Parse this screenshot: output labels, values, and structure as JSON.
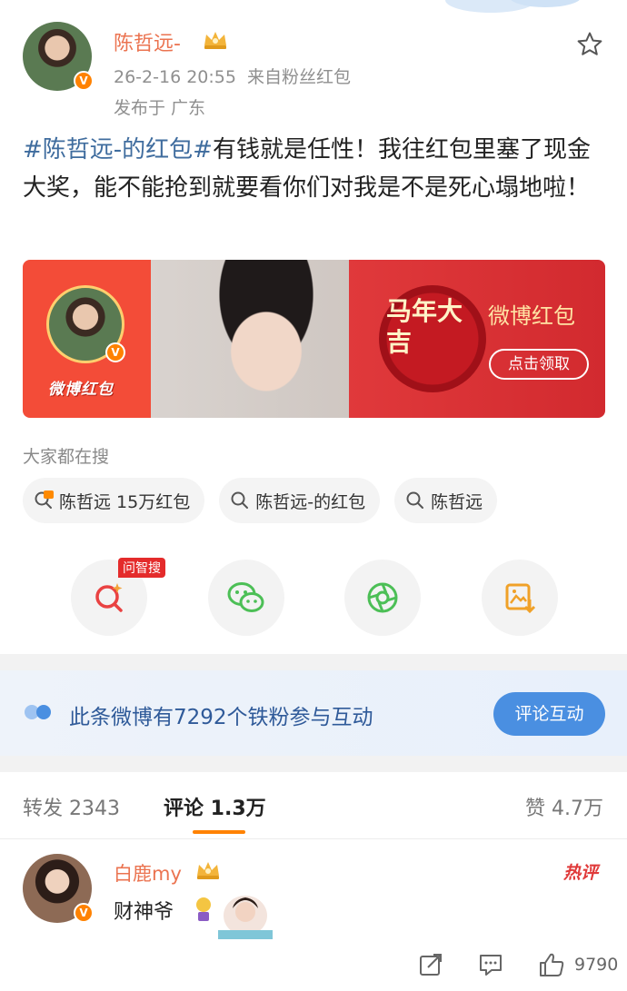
{
  "post": {
    "author": "陈哲远-",
    "time": "26-2-16 20:55",
    "source": "来自粉丝红包",
    "location": "发布于 广东",
    "hashtag": "#陈哲远-的红包#",
    "text": "有钱就是任性！我往红包里塞了现金大奖，能不能抢到就要看你们对我是不是死心塌地啦！"
  },
  "banner": {
    "logo_text": "微博红包",
    "horse_text": "马年大吉",
    "title": "微博红包",
    "claim": "点击领取"
  },
  "search": {
    "label": "大家都在搜",
    "chips": [
      "陈哲远 15万红包",
      "陈哲远-的红包",
      "陈哲远"
    ]
  },
  "share": {
    "ai_tag": "问智搜",
    "icons": [
      "ai-search-icon",
      "wechat-icon",
      "moments-icon",
      "save-image-icon"
    ]
  },
  "fan_banner": {
    "text": "此条微博有7292个铁粉参与互动",
    "button": "评论互动"
  },
  "tabs": {
    "repost": "转发 2343",
    "comment": "评论 1.3万",
    "like": "赞 4.7万"
  },
  "comment": {
    "name": "白鹿my",
    "badge": "热评",
    "text": "财神爷",
    "likes": "9790"
  },
  "colors": {
    "accent": "#ff8200",
    "name": "#eb7350",
    "link": "#3f6c9e",
    "fan_button": "#4a8fe1"
  }
}
